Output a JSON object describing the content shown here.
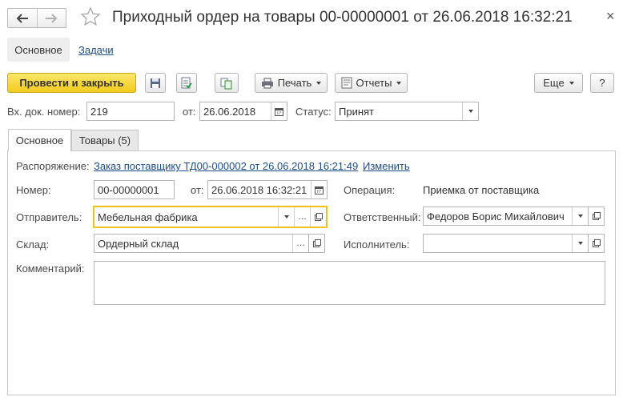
{
  "header": {
    "title": "Приходный ордер на товары 00-00000001 от 26.06.2018 16:32:21",
    "back_icon": "arrow-left-icon",
    "forward_icon": "arrow-right-icon",
    "favorite_icon": "star-icon",
    "close_label": "×"
  },
  "sections": {
    "main_label": "Основное",
    "tasks_label": "Задачи"
  },
  "toolbar": {
    "post_close_label": "Провести и закрыть",
    "print_label": "Печать",
    "reports_label": "Отчеты",
    "more_label": "Еще",
    "help_label": "?"
  },
  "doc_fields": {
    "incoming_no_label": "Вх. док. номер:",
    "incoming_no_value": "219",
    "from_label": "от:",
    "from_value": "26.06.2018",
    "status_label": "Статус:",
    "status_value": "Принят"
  },
  "tabs": [
    {
      "label": "Основное"
    },
    {
      "label": "Товары (5)"
    }
  ],
  "form": {
    "order_label": "Распоряжение:",
    "order_link": "Заказ поставщику ТД00-000002 от 26.06.2018 16:21:49",
    "change_link": "Изменить",
    "number_label": "Номер:",
    "number_value": "00-00000001",
    "date_label": "от:",
    "date_value": "26.06.2018 16:32:21",
    "operation_label": "Операция:",
    "operation_value": "Приемка от поставщика",
    "sender_label": "Отправитель:",
    "sender_value": "Мебельная фабрика",
    "responsible_label": "Ответственный:",
    "responsible_value": "Федоров Борис Михайлович",
    "warehouse_label": "Склад:",
    "warehouse_value": "Ордерный склад",
    "executor_label": "Исполнитель:",
    "executor_value": "",
    "comment_label": "Комментарий:",
    "comment_value": ""
  },
  "colors": {
    "accent_yellow": "#f5d53a",
    "link_blue": "#1c4d8c",
    "focus_border": "#f0c31b"
  }
}
